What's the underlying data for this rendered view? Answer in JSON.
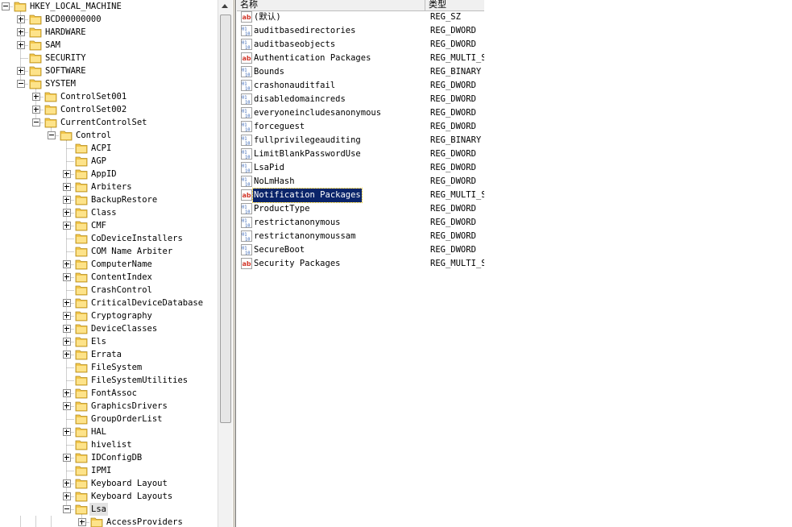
{
  "tree": {
    "nodes": [
      {
        "label": "HKEY_LOCAL_MACHINE",
        "level": 0,
        "expander": "minus"
      },
      {
        "label": "BCD00000000",
        "level": 1,
        "expander": "plus"
      },
      {
        "label": "HARDWARE",
        "level": 1,
        "expander": "plus"
      },
      {
        "label": "SAM",
        "level": 1,
        "expander": "plus"
      },
      {
        "label": "SECURITY",
        "level": 1,
        "expander": "none"
      },
      {
        "label": "SOFTWARE",
        "level": 1,
        "expander": "plus"
      },
      {
        "label": "SYSTEM",
        "level": 1,
        "expander": "minus"
      },
      {
        "label": "ControlSet001",
        "level": 2,
        "expander": "plus"
      },
      {
        "label": "ControlSet002",
        "level": 2,
        "expander": "plus"
      },
      {
        "label": "CurrentControlSet",
        "level": 2,
        "expander": "minus"
      },
      {
        "label": "Control",
        "level": 3,
        "expander": "minus"
      },
      {
        "label": "ACPI",
        "level": 4,
        "expander": "none"
      },
      {
        "label": "AGP",
        "level": 4,
        "expander": "none"
      },
      {
        "label": "AppID",
        "level": 4,
        "expander": "plus"
      },
      {
        "label": "Arbiters",
        "level": 4,
        "expander": "plus"
      },
      {
        "label": "BackupRestore",
        "level": 4,
        "expander": "plus"
      },
      {
        "label": "Class",
        "level": 4,
        "expander": "plus"
      },
      {
        "label": "CMF",
        "level": 4,
        "expander": "plus"
      },
      {
        "label": "CoDeviceInstallers",
        "level": 4,
        "expander": "none"
      },
      {
        "label": "COM Name Arbiter",
        "level": 4,
        "expander": "none"
      },
      {
        "label": "ComputerName",
        "level": 4,
        "expander": "plus"
      },
      {
        "label": "ContentIndex",
        "level": 4,
        "expander": "plus"
      },
      {
        "label": "CrashControl",
        "level": 4,
        "expander": "none"
      },
      {
        "label": "CriticalDeviceDatabase",
        "level": 4,
        "expander": "plus"
      },
      {
        "label": "Cryptography",
        "level": 4,
        "expander": "plus"
      },
      {
        "label": "DeviceClasses",
        "level": 4,
        "expander": "plus"
      },
      {
        "label": "Els",
        "level": 4,
        "expander": "plus"
      },
      {
        "label": "Errata",
        "level": 4,
        "expander": "plus"
      },
      {
        "label": "FileSystem",
        "level": 4,
        "expander": "none"
      },
      {
        "label": "FileSystemUtilities",
        "level": 4,
        "expander": "none"
      },
      {
        "label": "FontAssoc",
        "level": 4,
        "expander": "plus"
      },
      {
        "label": "GraphicsDrivers",
        "level": 4,
        "expander": "plus"
      },
      {
        "label": "GroupOrderList",
        "level": 4,
        "expander": "none"
      },
      {
        "label": "HAL",
        "level": 4,
        "expander": "plus"
      },
      {
        "label": "hivelist",
        "level": 4,
        "expander": "none"
      },
      {
        "label": "IDConfigDB",
        "level": 4,
        "expander": "plus"
      },
      {
        "label": "IPMI",
        "level": 4,
        "expander": "none"
      },
      {
        "label": "Keyboard Layout",
        "level": 4,
        "expander": "plus"
      },
      {
        "label": "Keyboard Layouts",
        "level": 4,
        "expander": "plus"
      },
      {
        "label": "Lsa",
        "level": 4,
        "expander": "minus",
        "selected": true
      },
      {
        "label": "AccessProviders",
        "level": 5,
        "expander": "plus"
      }
    ]
  },
  "list": {
    "columns": {
      "name": "名称",
      "type": "类型"
    },
    "values": [
      {
        "icon": "string-value-icon",
        "name": "(默认)",
        "type": "REG_SZ"
      },
      {
        "icon": "binary-value-icon",
        "name": "auditbasedirectories",
        "type": "REG_DWORD"
      },
      {
        "icon": "binary-value-icon",
        "name": "auditbaseobjects",
        "type": "REG_DWORD"
      },
      {
        "icon": "string-value-icon",
        "name": "Authentication Packages",
        "type": "REG_MULTI_SZ"
      },
      {
        "icon": "binary-value-icon",
        "name": "Bounds",
        "type": "REG_BINARY"
      },
      {
        "icon": "binary-value-icon",
        "name": "crashonauditfail",
        "type": "REG_DWORD"
      },
      {
        "icon": "binary-value-icon",
        "name": "disabledomaincreds",
        "type": "REG_DWORD"
      },
      {
        "icon": "binary-value-icon",
        "name": "everyoneincludesanonymous",
        "type": "REG_DWORD"
      },
      {
        "icon": "binary-value-icon",
        "name": "forceguest",
        "type": "REG_DWORD"
      },
      {
        "icon": "binary-value-icon",
        "name": "fullprivilegeauditing",
        "type": "REG_BINARY"
      },
      {
        "icon": "binary-value-icon",
        "name": "LimitBlankPasswordUse",
        "type": "REG_DWORD"
      },
      {
        "icon": "binary-value-icon",
        "name": "LsaPid",
        "type": "REG_DWORD"
      },
      {
        "icon": "binary-value-icon",
        "name": "NoLmHash",
        "type": "REG_DWORD"
      },
      {
        "icon": "string-value-icon",
        "name": "Notification Packages",
        "type": "REG_MULTI_SZ",
        "selected": true
      },
      {
        "icon": "binary-value-icon",
        "name": "ProductType",
        "type": "REG_DWORD"
      },
      {
        "icon": "binary-value-icon",
        "name": "restrictanonymous",
        "type": "REG_DWORD"
      },
      {
        "icon": "binary-value-icon",
        "name": "restrictanonymoussam",
        "type": "REG_DWORD"
      },
      {
        "icon": "binary-value-icon",
        "name": "SecureBoot",
        "type": "REG_DWORD"
      },
      {
        "icon": "string-value-icon",
        "name": "Security Packages",
        "type": "REG_MULTI_SZ"
      }
    ]
  },
  "colors": {
    "selection": "#0a246a",
    "folder": "#f3c64a",
    "string_icon": "#d2372a",
    "binary_icon": "#2f5fb3"
  }
}
